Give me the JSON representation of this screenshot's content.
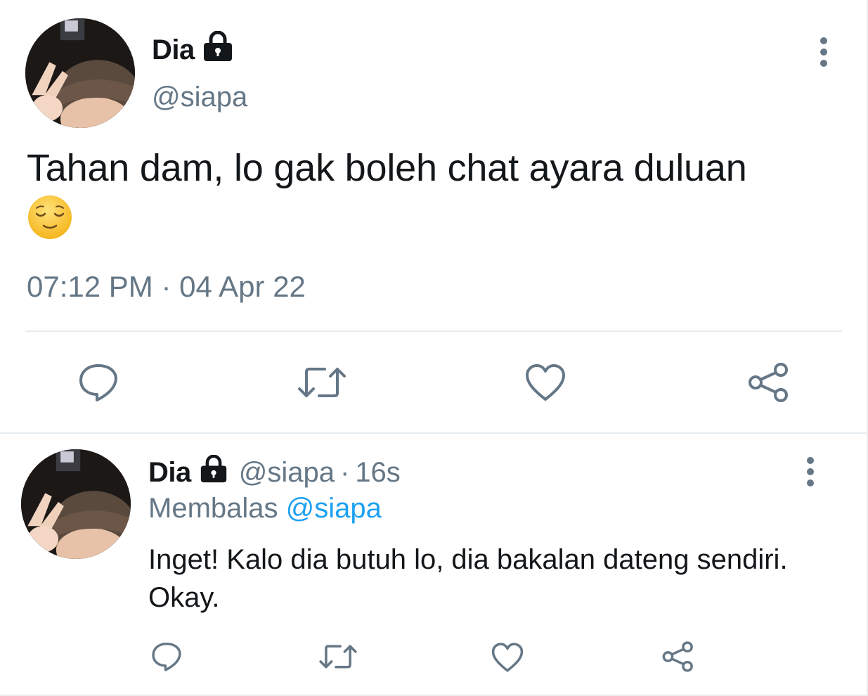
{
  "main_tweet": {
    "name": "Dia",
    "handle": "@siapa",
    "text": "Tahan dam, lo gak boleh chat ayara duluan",
    "emoji": "relieved-face",
    "timestamp": "07:12 PM · 04 Apr 22"
  },
  "reply": {
    "name": "Dia",
    "handle": "@siapa",
    "separator": "·",
    "time_ago": "16s",
    "replying_label": "Membalas",
    "replying_to": "@siapa",
    "text": "Inget! Kalo dia butuh lo, dia bakalan dateng sendiri. Okay."
  },
  "icons": {
    "lock": "lock-icon",
    "more": "more-vertical-icon",
    "reply": "comment-icon",
    "retweet": "retweet-icon",
    "like": "heart-icon",
    "share": "share-icon"
  },
  "colors": {
    "text": "#14171a",
    "secondary": "#657786",
    "link": "#1da1f2",
    "divider": "#e6ecf0"
  }
}
